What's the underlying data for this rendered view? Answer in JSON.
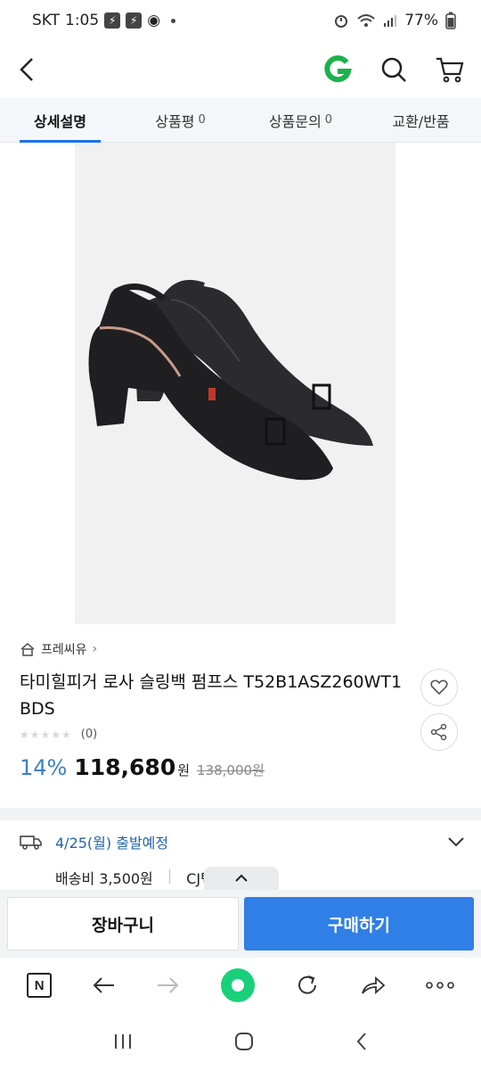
{
  "status_bar": {
    "carrier": "SKT",
    "time": "1:05",
    "battery": "77%"
  },
  "header": {
    "brand_letter": "G"
  },
  "tabs": [
    {
      "label": "상세설명",
      "count": ""
    },
    {
      "label": "상품평",
      "count": "0"
    },
    {
      "label": "상품문의",
      "count": "0"
    },
    {
      "label": "교환/반품",
      "count": ""
    }
  ],
  "product": {
    "seller": "프레씨유",
    "title": "타미힐피거 로사 슬링백 펌프스 T52B1ASZ260WT1 BDS",
    "rating_count": "(0)",
    "discount": "14%",
    "price": "118,680",
    "price_unit": "원",
    "original_price": "138,000원"
  },
  "shipping": {
    "date": "4/25(월) 출발예정",
    "fee": "배송비 3,500원",
    "carrier": "CJ택배"
  },
  "buy_bar": {
    "cart_label": "장바구니",
    "buy_label": "구매하기"
  },
  "browser": {
    "n_label": "N"
  },
  "colors": {
    "accent": "#2f7fe6",
    "discount": "#3b82c4",
    "brand_green": "#1bb24b"
  }
}
